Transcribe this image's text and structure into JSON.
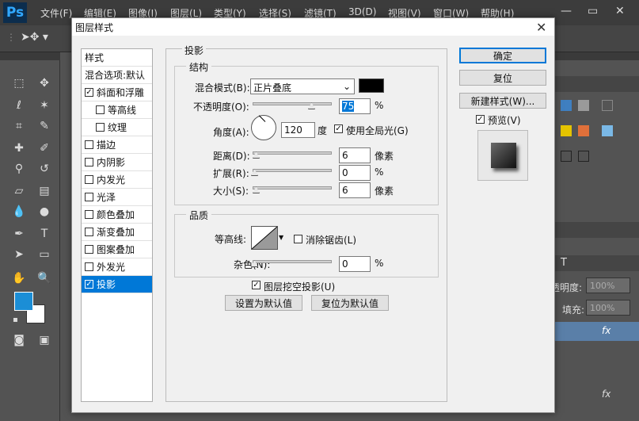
{
  "app": {
    "logo": "Ps"
  },
  "menu": [
    "文件(F)",
    "编辑(E)",
    "图像(I)",
    "图层(L)",
    "类型(Y)",
    "选择(S)",
    "滤镜(T)",
    "3D(D)",
    "视图(V)",
    "窗口(W)",
    "帮助(H)"
  ],
  "right_panel": {
    "opacity_label": "透明度:",
    "opacity_value": "100%",
    "fill_label": "填充:",
    "fill_value": "100%"
  },
  "dialog": {
    "title": "图层样式",
    "style_list": [
      {
        "label": "样式",
        "checkbox": false
      },
      {
        "label": "混合选项:默认",
        "checkbox": false
      },
      {
        "label": "斜面和浮雕",
        "checkbox": true,
        "checked": true
      },
      {
        "label": "等高线",
        "checkbox": true,
        "checked": false,
        "indent": true
      },
      {
        "label": "纹理",
        "checkbox": true,
        "checked": false,
        "indent": true
      },
      {
        "label": "描边",
        "checkbox": true,
        "checked": false
      },
      {
        "label": "内阴影",
        "checkbox": true,
        "checked": false
      },
      {
        "label": "内发光",
        "checkbox": true,
        "checked": false
      },
      {
        "label": "光泽",
        "checkbox": true,
        "checked": false
      },
      {
        "label": "颜色叠加",
        "checkbox": true,
        "checked": false
      },
      {
        "label": "渐变叠加",
        "checkbox": true,
        "checked": false
      },
      {
        "label": "图案叠加",
        "checkbox": true,
        "checked": false
      },
      {
        "label": "外发光",
        "checkbox": true,
        "checked": false
      },
      {
        "label": "投影",
        "checkbox": true,
        "checked": true,
        "selected": true
      }
    ],
    "section_title": "投影",
    "structure": {
      "title": "结构",
      "blend_mode_label": "混合模式(B):",
      "blend_mode_value": "正片叠底",
      "blend_color": "#000000",
      "opacity_label": "不透明度(O):",
      "opacity_value": "75",
      "opacity_unit": "%",
      "angle_label": "角度(A):",
      "angle_value": "120",
      "angle_unit": "度",
      "global_light_label": "使用全局光(G)",
      "distance_label": "距离(D):",
      "distance_value": "6",
      "distance_unit": "像素",
      "spread_label": "扩展(R):",
      "spread_value": "0",
      "spread_unit": "%",
      "size_label": "大小(S):",
      "size_value": "6",
      "size_unit": "像素"
    },
    "quality": {
      "title": "品质",
      "contour_label": "等高线:",
      "antialias_label": "消除锯齿(L)",
      "noise_label": "杂色(N):",
      "noise_value": "0",
      "noise_unit": "%"
    },
    "knockout_label": "图层挖空投影(U)",
    "make_default_label": "设置为默认值",
    "reset_default_label": "复位为默认值",
    "ok_label": "确定",
    "reset_label": "复位",
    "new_style_label": "新建样式(W)...",
    "preview_label": "预览(V)"
  }
}
